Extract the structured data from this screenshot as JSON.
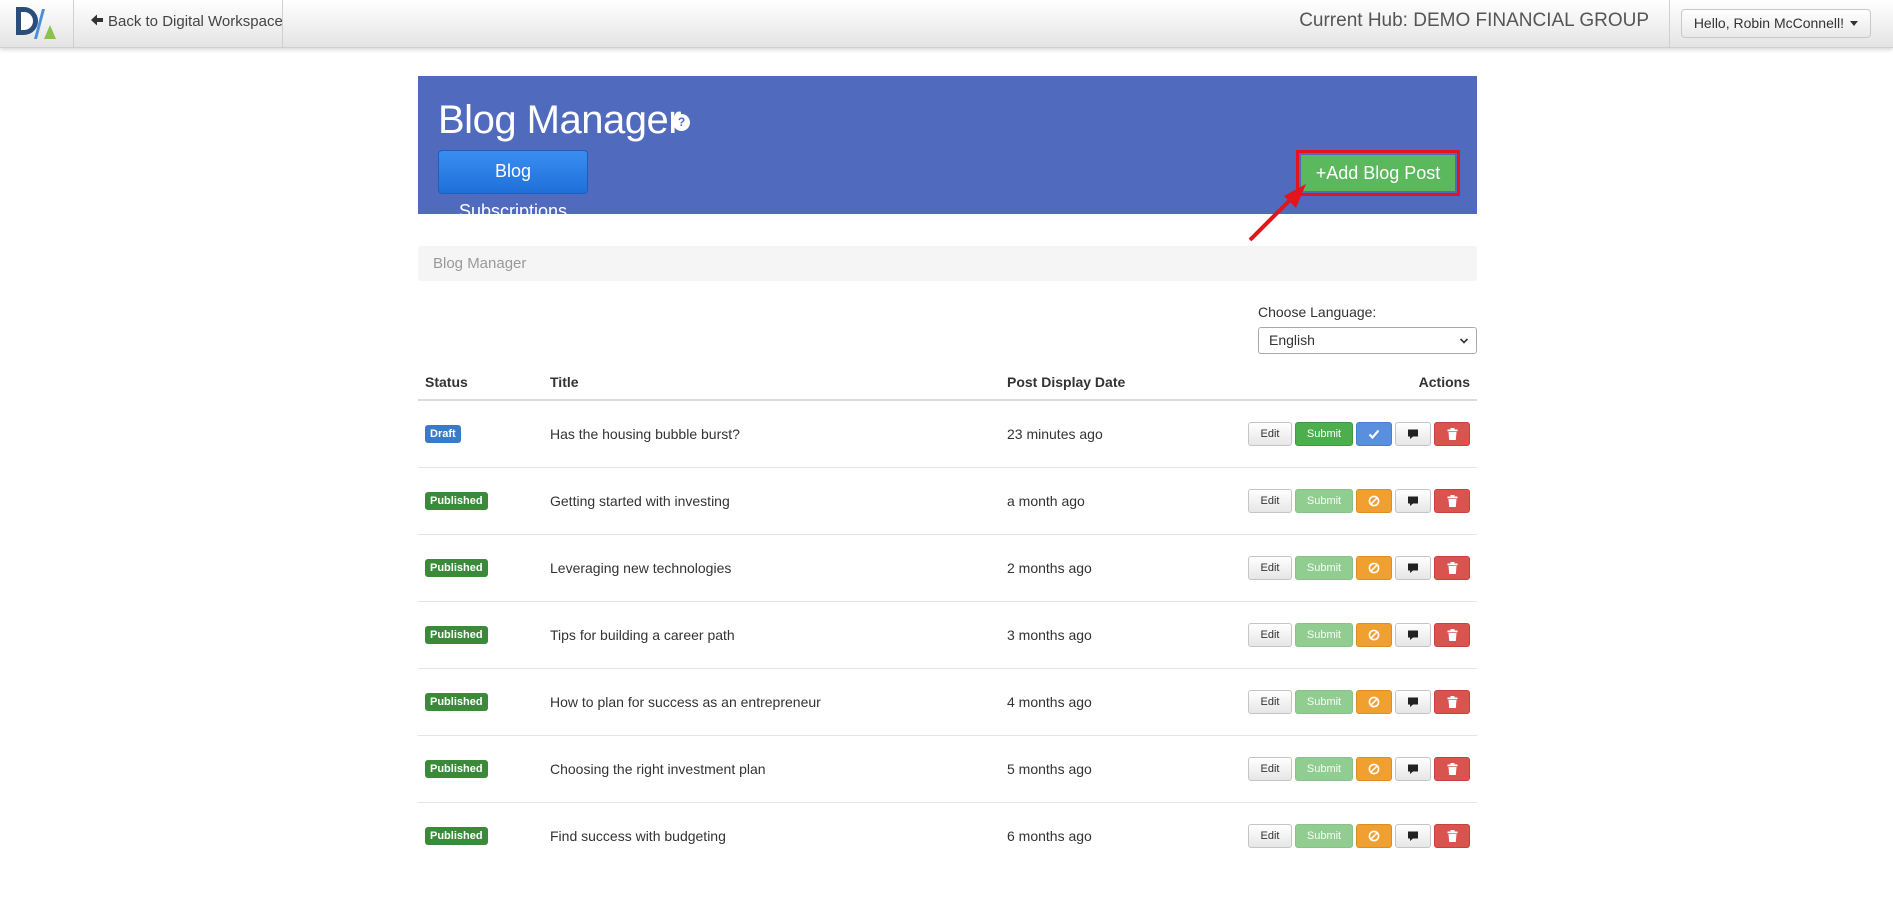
{
  "nav": {
    "back_label": "Back to Digital Workspace",
    "hub_label": "Current Hub: DEMO FINANCIAL GROUP",
    "user_label": "Hello, Robin McConnell!"
  },
  "header": {
    "title": "Blog Manager",
    "subscriptions_label": "Blog Subscriptions",
    "add_post_label": "+Add Blog Post"
  },
  "breadcrumb": {
    "current": "Blog Manager"
  },
  "language": {
    "label": "Choose Language:",
    "selected": "English"
  },
  "table": {
    "columns": [
      "Status",
      "Title",
      "Post Display Date",
      "Actions"
    ],
    "rows": [
      {
        "status": "Draft",
        "title": "Has the housing bubble burst?",
        "date": "23 minutes ago",
        "edit": "Edit",
        "submit": "Submit"
      },
      {
        "status": "Published",
        "title": "Getting started with investing",
        "date": "a month ago",
        "edit": "Edit",
        "submit": "Submit"
      },
      {
        "status": "Published",
        "title": "Leveraging new technologies",
        "date": "2 months ago",
        "edit": "Edit",
        "submit": "Submit"
      },
      {
        "status": "Published",
        "title": "Tips for building a career path",
        "date": "3 months ago",
        "edit": "Edit",
        "submit": "Submit"
      },
      {
        "status": "Published",
        "title": "How to plan for success as an entrepreneur",
        "date": "4 months ago",
        "edit": "Edit",
        "submit": "Submit"
      },
      {
        "status": "Published",
        "title": "Choosing the right investment plan",
        "date": "5 months ago",
        "edit": "Edit",
        "submit": "Submit"
      },
      {
        "status": "Published",
        "title": "Find success with budgeting",
        "date": "6 months ago",
        "edit": "Edit",
        "submit": "Submit"
      }
    ]
  },
  "colors": {
    "header_bg": "#506bbd",
    "primary_blue": "#1f6fd8",
    "success_green": "#5cb85c",
    "highlight_red": "#e3141b",
    "warning_orange": "#f0a030",
    "danger_red": "#d9534f"
  },
  "icons": {
    "back": "arrow-left-icon",
    "help": "question-circle-icon",
    "approve": "check-icon",
    "unpublish": "ban-icon",
    "comment": "comment-icon",
    "delete": "trash-icon"
  }
}
